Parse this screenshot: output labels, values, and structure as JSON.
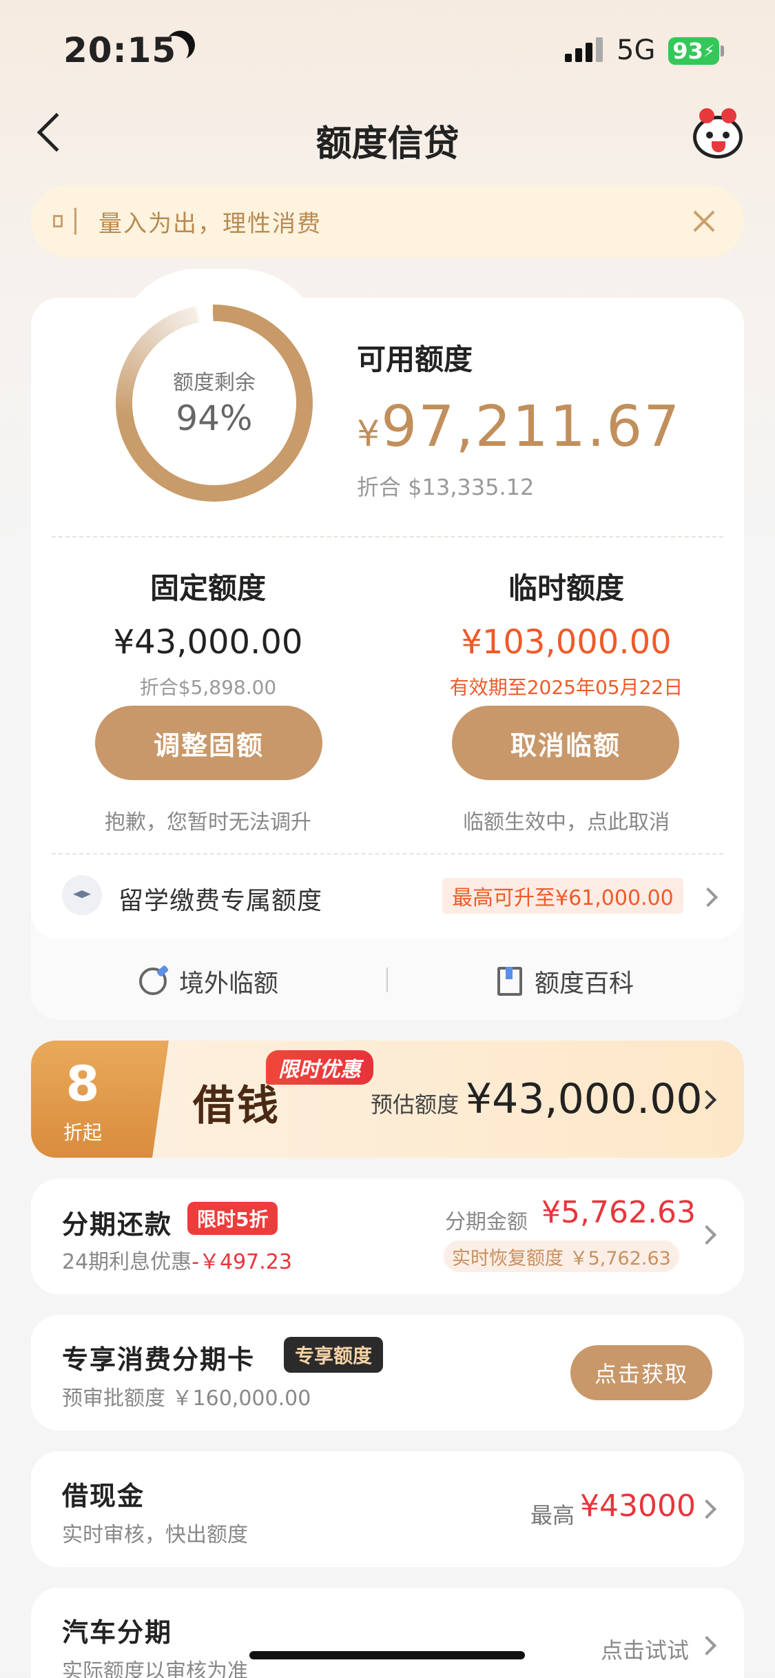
{
  "status": {
    "time": "20:15",
    "network": "5G",
    "battery": "93"
  },
  "nav": {
    "title": "额度信贷"
  },
  "notice": {
    "text": "量入为出，理性消费"
  },
  "credit": {
    "ring_label": "额度剩余",
    "ring_percent": "94%",
    "remaining_fraction": 0.94,
    "available_label": "可用额度",
    "currency_symbol": "¥",
    "available_amount": "97,211.67",
    "available_usd": "折合 $13,335.12"
  },
  "fixed": {
    "title": "固定额度",
    "amount": "¥43,000.00",
    "sub": "折合$5,898.00",
    "button": "调整固额",
    "note": "抱歉，您暂时无法调升"
  },
  "temp": {
    "title": "临时额度",
    "amount": "¥103,000.00",
    "sub": "有效期至2025年05月22日",
    "button": "取消临额",
    "note": "临额生效中，点此取消"
  },
  "study": {
    "label": "留学缴费专属额度",
    "tag": "最高可升至¥61,000.00"
  },
  "links": {
    "overseas": "境外临额",
    "wiki": "额度百科"
  },
  "borrow": {
    "discount_num": "8",
    "discount_sub": "折起",
    "title": "借钱",
    "tag": "限时优惠",
    "est_label": "预估额度",
    "est_amount": "¥43,000.00"
  },
  "installment": {
    "title": "分期还款",
    "tag": "限时5折",
    "sub_prefix": "24期利息优惠",
    "sub_amount": "-￥497.23",
    "amount_label": "分期金额",
    "amount": "¥5,762.63",
    "recover": "实时恢复额度 ￥5,762.63"
  },
  "card_offer": {
    "title": "专享消费分期卡",
    "tag": "专享额度",
    "sub": "预审批额度 ￥160,000.00",
    "button": "点击获取"
  },
  "cash": {
    "title": "借现金",
    "sub": "实时审核，快出额度",
    "max_label": "最高",
    "max_amount": "¥43000"
  },
  "car": {
    "title": "汽车分期",
    "sub": "实际额度以审核为准",
    "action": "点击试试"
  },
  "colors": {
    "accent": "#c8986a",
    "red": "#e8353c",
    "orange": "#ef5a2a"
  }
}
